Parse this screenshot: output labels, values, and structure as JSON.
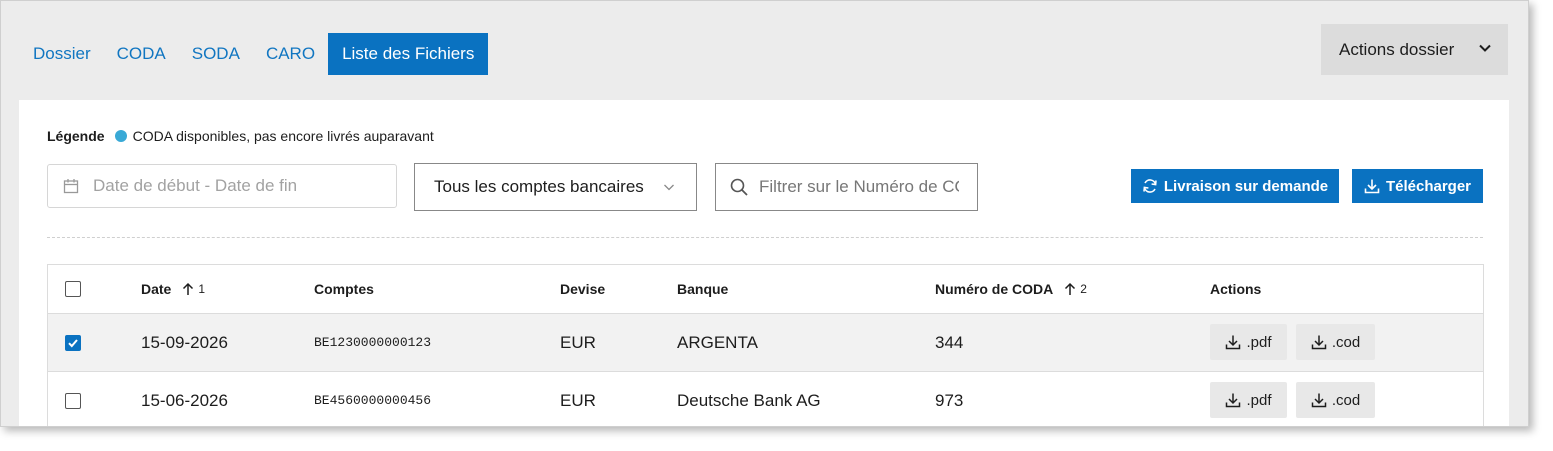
{
  "tabs": [
    {
      "label": "Dossier",
      "active": false
    },
    {
      "label": "CODA",
      "active": false
    },
    {
      "label": "SODA",
      "active": false
    },
    {
      "label": "CARO",
      "active": false
    },
    {
      "label": "Liste des Fichiers",
      "active": true
    }
  ],
  "actions_dossier": {
    "label": "Actions dossier",
    "icon": "chevron-down-icon"
  },
  "legend": {
    "title": "Légende",
    "dot_color": "#39a9d6",
    "text": "CODA disponibles, pas encore livrés auparavant"
  },
  "filters": {
    "date_range": {
      "placeholder": "Date de début - Date de fin",
      "value": "",
      "icon": "calendar-icon"
    },
    "account_select": {
      "value": "Tous les comptes bancaires",
      "icon": "chevron-down-icon"
    },
    "search": {
      "placeholder": "Filtrer sur le Numéro de CODA",
      "value": "",
      "icon": "search-icon"
    }
  },
  "buttons": {
    "livraison": {
      "label": "Livraison sur demande",
      "icon": "refresh-icon"
    },
    "telecharger": {
      "label": "Télécharger",
      "icon": "download-icon"
    }
  },
  "table": {
    "columns": [
      {
        "label": "Date",
        "sort_order": "1",
        "sort_dir": "asc"
      },
      {
        "label": "Comptes"
      },
      {
        "label": "Devise"
      },
      {
        "label": "Banque"
      },
      {
        "label": "Numéro de CODA",
        "sort_order": "2",
        "sort_dir": "asc"
      },
      {
        "label": "Actions"
      }
    ],
    "rows": [
      {
        "checked": true,
        "date": "15-09-2026",
        "account": "BE1230000000123",
        "currency": "EUR",
        "bank": "ARGENTA",
        "coda_number": "344",
        "pdf_label": ".pdf",
        "cod_label": ".cod"
      },
      {
        "checked": false,
        "date": "15-06-2026",
        "account": "BE4560000000456",
        "currency": "EUR",
        "bank": "Deutsche Bank AG",
        "coda_number": "973",
        "pdf_label": ".pdf",
        "cod_label": ".cod"
      }
    ]
  },
  "colors": {
    "primary": "#0a72c1",
    "link": "#1176c1",
    "background": "#ececec"
  }
}
